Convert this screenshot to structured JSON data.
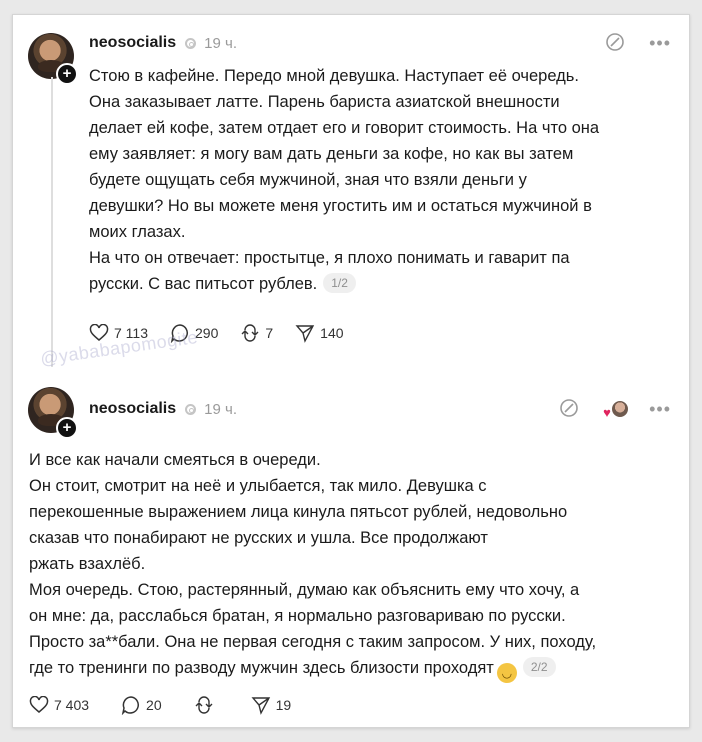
{
  "posts": [
    {
      "username": "neosocialis",
      "time": "19 ч.",
      "text": "Стою в кафейне. Передо мной девушка. Наступает её очередь.\nОна заказывает латте. Парень бариста азиатской внешности\nделает ей кофе, затем отдает его и говорит стоимость. На что она\nему заявляет: я могу вам дать деньги за кофе, но как вы затем\nбудете ощущать себя мужчиной, зная что взяли деньги у\nдевушки? Но вы можете меня угостить им и остаться мужчиной в\nмоих глазах.\nНа что он отвечает: простытце, я плохо понимать и гаварит па\nрусски. С вас питьсот рублев.",
      "counter": "1/2",
      "stats": {
        "likes": "7 113",
        "replies": "290",
        "reposts": "7",
        "shares": "140"
      }
    },
    {
      "username": "neosocialis",
      "time": "19 ч.",
      "text": "И все как начали смеяться в очереди.\nОн стоит, смотрит на неё и улыбается, так мило. Девушка с\nперекошенные выражением лица кинула пятьсот рублей, недовольно\nсказав что понабирают не русских и ушла. Все продолжают\nржать взахлёб.\nМоя очередь. Стою, растерянный, думаю как объяснить ему что хочу, а\nон мне: да, расслабься братан, я нормально разговариваю по русски.\nПросто за**бали. Она не первая сегодня с таким запросом. У них, походу,\nгде то тренинги по разводу мужчин здесь близости проходят",
      "counter": "2/2",
      "stats": {
        "likes": "7 403",
        "replies": "20",
        "reposts": "",
        "shares": "19"
      }
    }
  ],
  "watermark": "@yababapomogite",
  "icons": {
    "verified": "ring-icon",
    "edit": "pencil-circle-icon",
    "more": "more-icon",
    "like": "heart-icon",
    "reply": "comment-icon",
    "repost": "repost-icon",
    "share": "send-icon",
    "emoji": "laughing-emoji-icon"
  },
  "colors": {
    "text": "#1b1b1b",
    "muted": "#9a9a9a",
    "background": "#ffffff",
    "heart": "#e0245e"
  }
}
